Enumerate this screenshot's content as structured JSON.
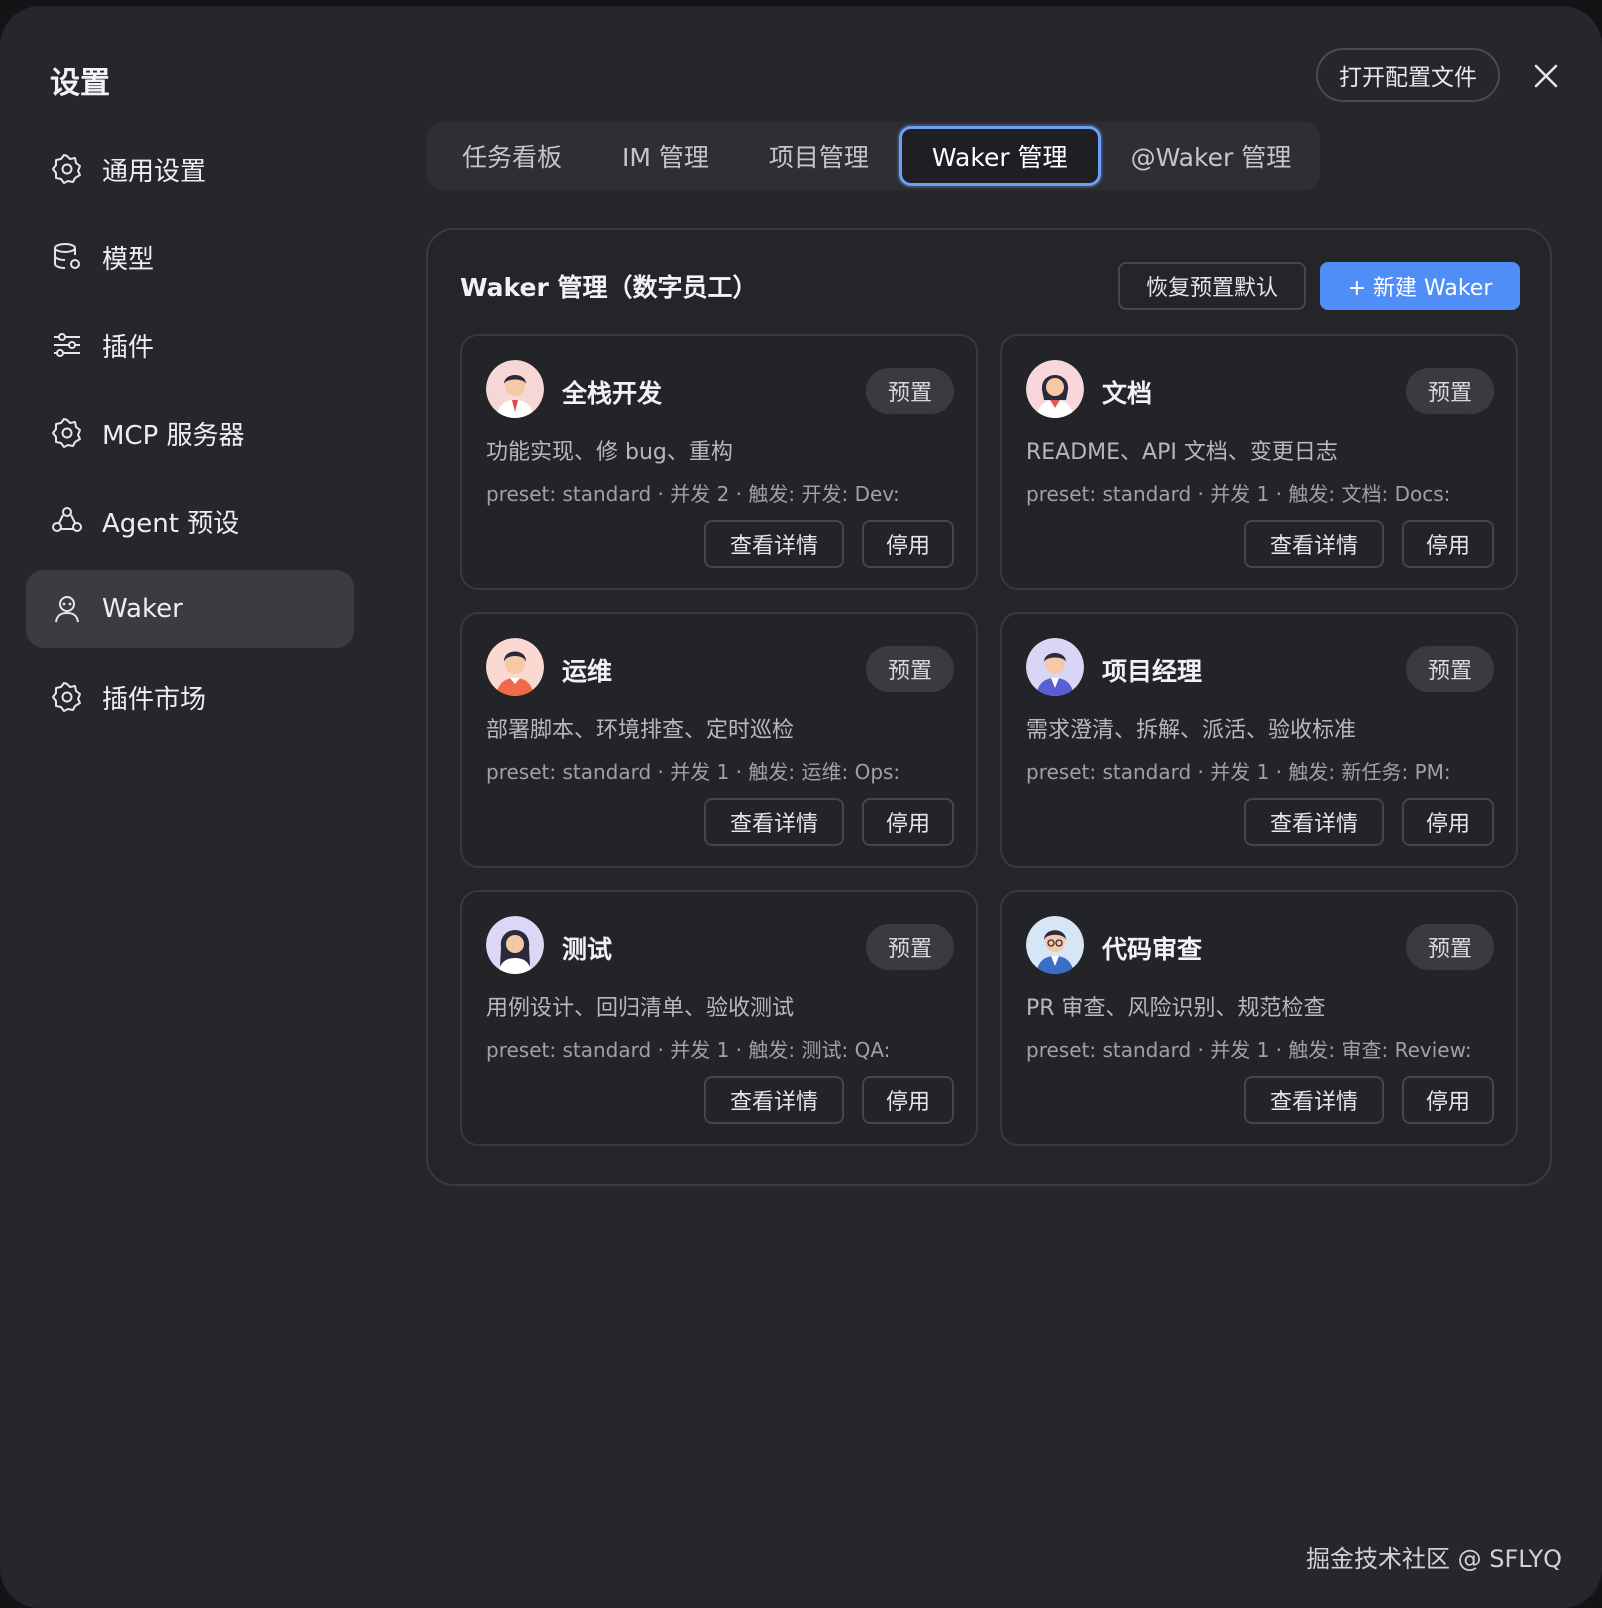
{
  "header": {
    "title": "设置",
    "open_config_label": "打开配置文件"
  },
  "sidebar": {
    "items": [
      {
        "label": "通用设置",
        "icon": "gear-icon"
      },
      {
        "label": "模型",
        "icon": "database-icon"
      },
      {
        "label": "插件",
        "icon": "sliders-icon"
      },
      {
        "label": "MCP 服务器",
        "icon": "gear-icon"
      },
      {
        "label": "Agent 预设",
        "icon": "robot-icon"
      },
      {
        "label": "Waker",
        "icon": "person-icon",
        "active": true
      },
      {
        "label": "插件市场",
        "icon": "gear-icon"
      }
    ]
  },
  "tabs": [
    {
      "label": "任务看板"
    },
    {
      "label": "IM 管理"
    },
    {
      "label": "项目管理"
    },
    {
      "label": "Waker 管理",
      "active": true
    },
    {
      "label": "@Waker 管理"
    }
  ],
  "panel": {
    "title": "Waker 管理（数字员工）",
    "restore_label": "恢复预置默认",
    "new_label": "+ 新建 Waker"
  },
  "cards": [
    {
      "name": "全栈开发",
      "badge": "预置",
      "desc": "功能实现、修 bug、重构",
      "meta": "preset: standard · 并发 2 · 触发: 开发: Dev:",
      "detail_label": "查看详情",
      "disable_label": "停用",
      "avatar_bg": "#f7d6d6"
    },
    {
      "name": "文档",
      "badge": "预置",
      "desc": "README、API 文档、变更日志",
      "meta": "preset: standard · 并发 1 · 触发: 文档: Docs:",
      "detail_label": "查看详情",
      "disable_label": "停用",
      "avatar_bg": "#f7d6dc"
    },
    {
      "name": "运维",
      "badge": "预置",
      "desc": "部署脚本、环境排查、定时巡检",
      "meta": "preset: standard · 并发 1 · 触发: 运维: Ops:",
      "detail_label": "查看详情",
      "disable_label": "停用",
      "avatar_bg": "#f9d9d2"
    },
    {
      "name": "项目经理",
      "badge": "预置",
      "desc": "需求澄清、拆解、派活、验收标准",
      "meta": "preset: standard · 并发 1 · 触发: 新任务: PM:",
      "detail_label": "查看详情",
      "disable_label": "停用",
      "avatar_bg": "#d9d6f5"
    },
    {
      "name": "测试",
      "badge": "预置",
      "desc": "用例设计、回归清单、验收测试",
      "meta": "preset: standard · 并发 1 · 触发: 测试: QA:",
      "detail_label": "查看详情",
      "disable_label": "停用",
      "avatar_bg": "#ddd6f7"
    },
    {
      "name": "代码审查",
      "badge": "预置",
      "desc": "PR 审查、风险识别、规范检查",
      "meta": "preset: standard · 并发 1 · 触发: 审查: Review:",
      "detail_label": "查看详情",
      "disable_label": "停用",
      "avatar_bg": "#d6e6f7"
    }
  ],
  "watermark": "掘金技术社区 @ SFLYQ",
  "colors": {
    "accent": "#4f8ef7",
    "background": "#26272b",
    "active_tab_border": "#6e9ff5"
  }
}
